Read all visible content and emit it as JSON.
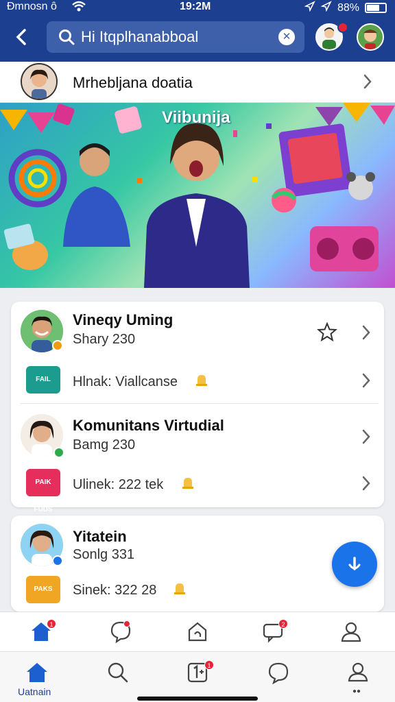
{
  "status_bar": {
    "carrier": "Ðmnosn ô",
    "time": "19:2M",
    "battery": "88%"
  },
  "header": {
    "search_value": "Hi Itqplhanabboal"
  },
  "profile": {
    "name": "Mrhebljana doatia"
  },
  "banner": {
    "title": "Viibunija"
  },
  "card1": {
    "rows": [
      {
        "title": "Vineqy Uming",
        "subtitle": "Shary 230"
      },
      {
        "link": "Hlnak: Viallcanse"
      },
      {
        "title": "Komunitans Virtudial",
        "subtitle": "Bamg 230"
      },
      {
        "link": "Ulinek: 222 tek"
      }
    ],
    "thumbs": [
      "FAIL RBGAL",
      "PAIK FUDS"
    ]
  },
  "card2": {
    "title": "Yitatein",
    "subtitle": "Sonlg 331",
    "link": "Sinek: 322 28",
    "thumb": "PAKS LIKLS"
  },
  "bottom_nav": {
    "home_label": "Uatnain"
  }
}
